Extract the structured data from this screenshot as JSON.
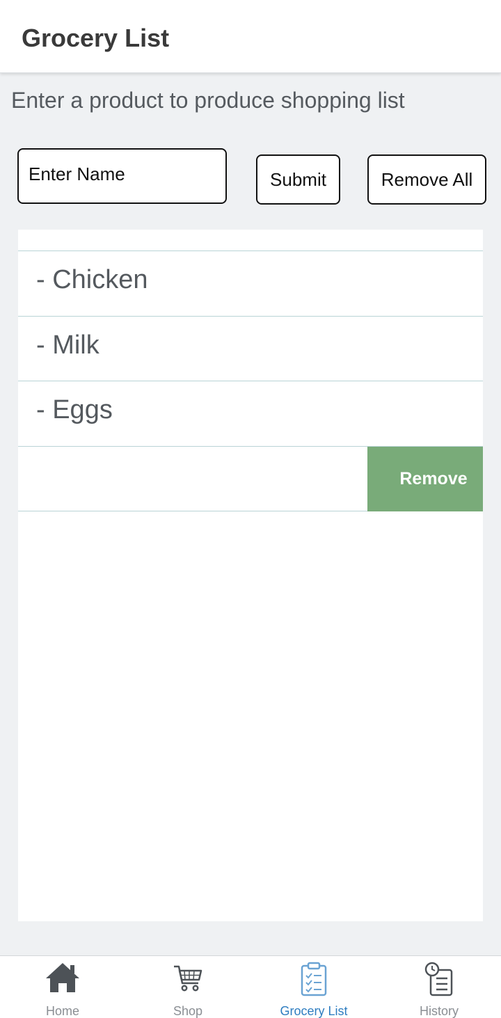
{
  "header": {
    "title": "Grocery List"
  },
  "subtitle": "Enter a product to produce shopping list",
  "form": {
    "name_placeholder": "Enter Name",
    "name_value": "",
    "submit_label": "Submit",
    "remove_all_label": "Remove All"
  },
  "list": {
    "items": [
      {
        "label": "- Chicken"
      },
      {
        "label": "- Milk"
      },
      {
        "label": "- Eggs"
      }
    ],
    "swiped_row": {
      "action_label": "Remove",
      "action_color": "#79ab79"
    }
  },
  "tabbar": {
    "active": "Grocery List",
    "active_color": "#2e7dc0",
    "tabs": [
      {
        "label": "Home",
        "icon": "home-icon"
      },
      {
        "label": "Shop",
        "icon": "cart-icon"
      },
      {
        "label": "Grocery List",
        "icon": "clipboard-checklist-icon"
      },
      {
        "label": "History",
        "icon": "history-list-icon"
      }
    ]
  }
}
